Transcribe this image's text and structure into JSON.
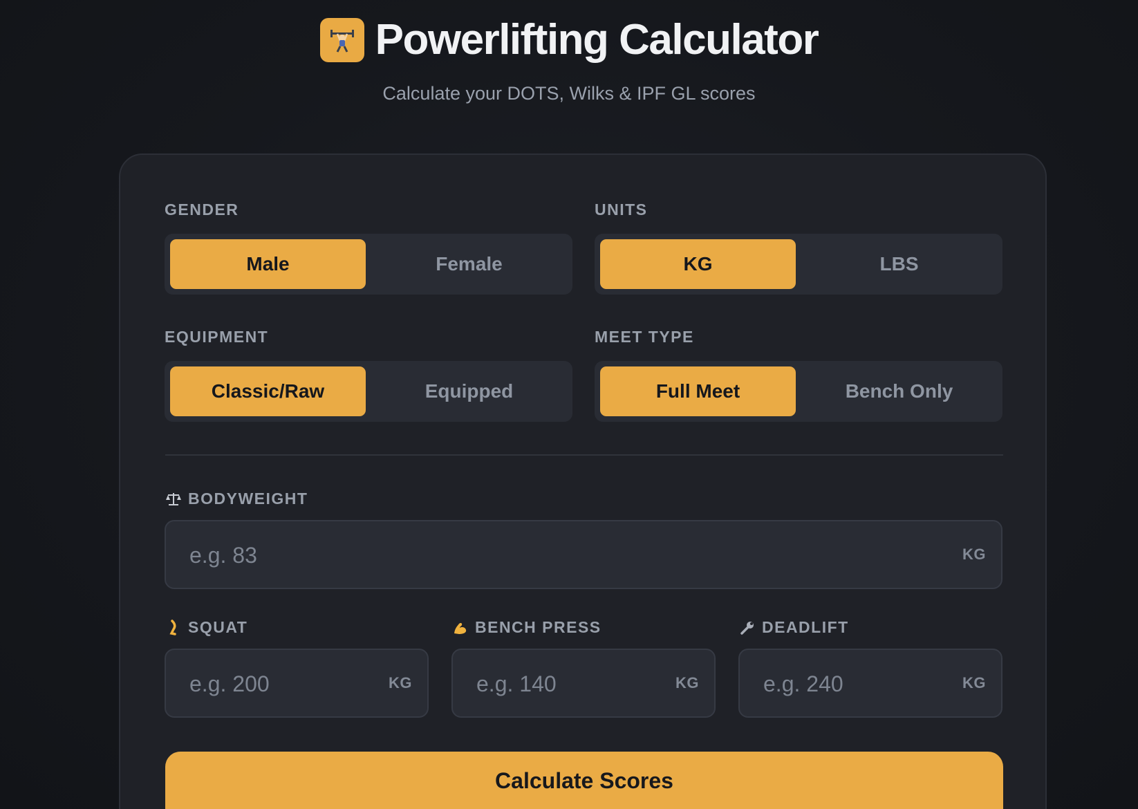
{
  "header": {
    "logo_icon": "weightlifter-icon",
    "title": "Powerlifting Calculator",
    "subtitle": "Calculate your DOTS, Wilks & IPF GL scores"
  },
  "colors": {
    "accent": "#eaab45",
    "background": "#16181d",
    "card": "#1f2127",
    "muted_text": "#99a0ab"
  },
  "form": {
    "gender": {
      "label": "GENDER",
      "options": [
        "Male",
        "Female"
      ],
      "selected": "Male"
    },
    "units": {
      "label": "UNITS",
      "options": [
        "KG",
        "LBS"
      ],
      "selected": "KG"
    },
    "equipment": {
      "label": "EQUIPMENT",
      "options": [
        "Classic/Raw",
        "Equipped"
      ],
      "selected": "Classic/Raw"
    },
    "meet_type": {
      "label": "MEET TYPE",
      "options": [
        "Full Meet",
        "Bench Only"
      ],
      "selected": "Full Meet"
    },
    "bodyweight": {
      "icon": "scale-icon",
      "label": "BODYWEIGHT",
      "placeholder": "e.g. 83",
      "value": "",
      "unit": "KG"
    },
    "squat": {
      "icon": "leg-icon",
      "label": "SQUAT",
      "placeholder": "e.g. 200",
      "value": "",
      "unit": "KG"
    },
    "bench": {
      "icon": "flexed-biceps-icon",
      "label": "BENCH PRESS",
      "placeholder": "e.g. 140",
      "value": "",
      "unit": "KG"
    },
    "deadlift": {
      "icon": "wrench-icon",
      "label": "DEADLIFT",
      "placeholder": "e.g. 240",
      "value": "",
      "unit": "KG"
    },
    "submit_label": "Calculate Scores"
  }
}
